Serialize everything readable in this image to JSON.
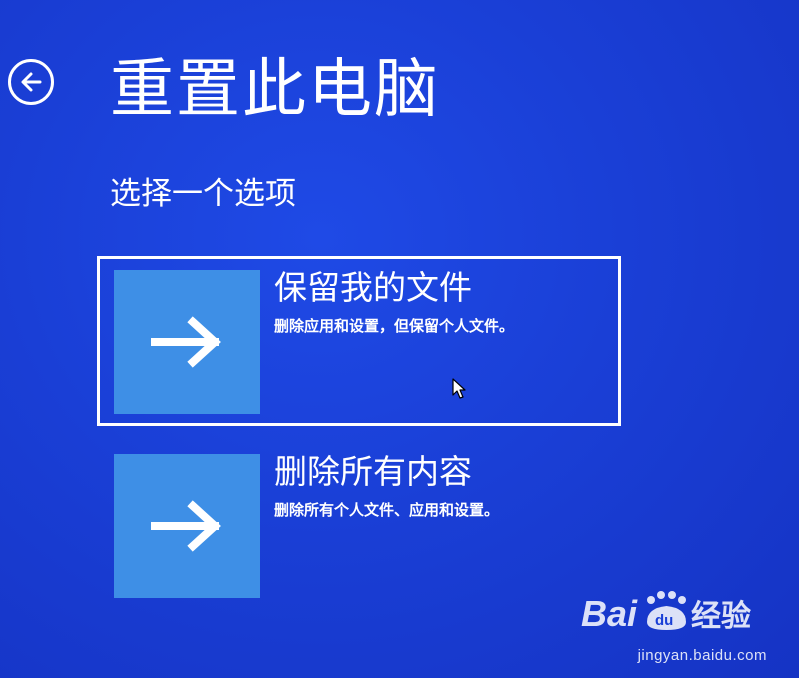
{
  "page": {
    "title": "重置此电脑",
    "subtitle": "选择一个选项"
  },
  "icons": {
    "back": "back-arrow-circle-icon",
    "option": "arrow-right-icon",
    "cursor": "mouse-pointer-icon"
  },
  "options": [
    {
      "title": "保留我的文件",
      "description": "删除应用和设置，但保留个人文件。",
      "selected": true
    },
    {
      "title": "删除所有内容",
      "description": "删除所有个人文件、应用和设置。",
      "selected": false
    }
  ],
  "watermark": {
    "logo_text": "Baidu经验",
    "url": "jingyan.baidu.com"
  },
  "colors": {
    "background": "#1a3fd6",
    "tile": "#3e8fe6",
    "text": "#ffffff"
  }
}
